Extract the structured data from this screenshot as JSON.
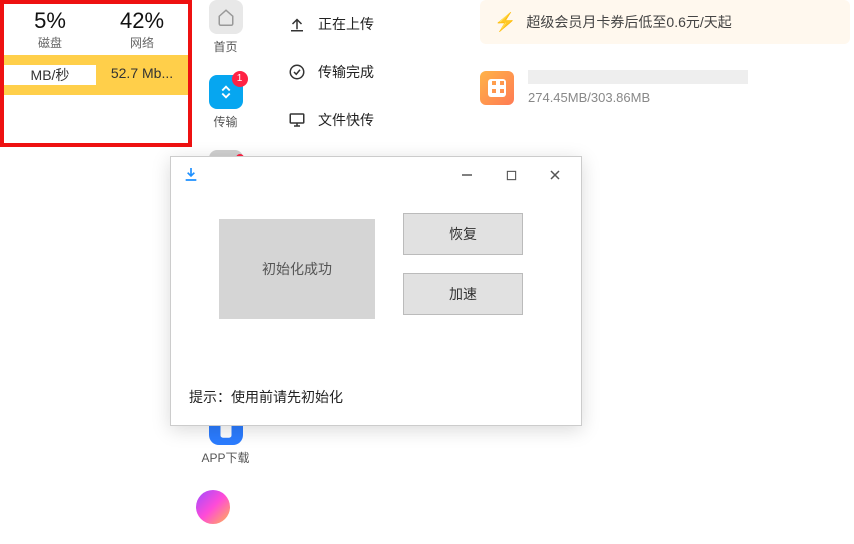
{
  "taskmgr": {
    "disk_pct": "5%",
    "net_pct": "42%",
    "disk_label": "磁盘",
    "net_label": "网络",
    "disk_rate": "MB/秒",
    "net_rate": "52.7 Mb..."
  },
  "sidebar": {
    "home": "首页",
    "transfer": "传输",
    "transfer_badge": "1",
    "app": "APP下载"
  },
  "midmenu": {
    "items": [
      {
        "label": "正在上传"
      },
      {
        "label": "传输完成"
      },
      {
        "label": "文件快传"
      }
    ]
  },
  "banner": {
    "text": "超级会员月卡券后低至0.6元/天起"
  },
  "download": {
    "progress": "274.45MB/303.86MB"
  },
  "dialog": {
    "init_text": "初始化成功",
    "restore": "恢复",
    "speedup": "加速",
    "hint": "提示：使用前请先初始化"
  }
}
